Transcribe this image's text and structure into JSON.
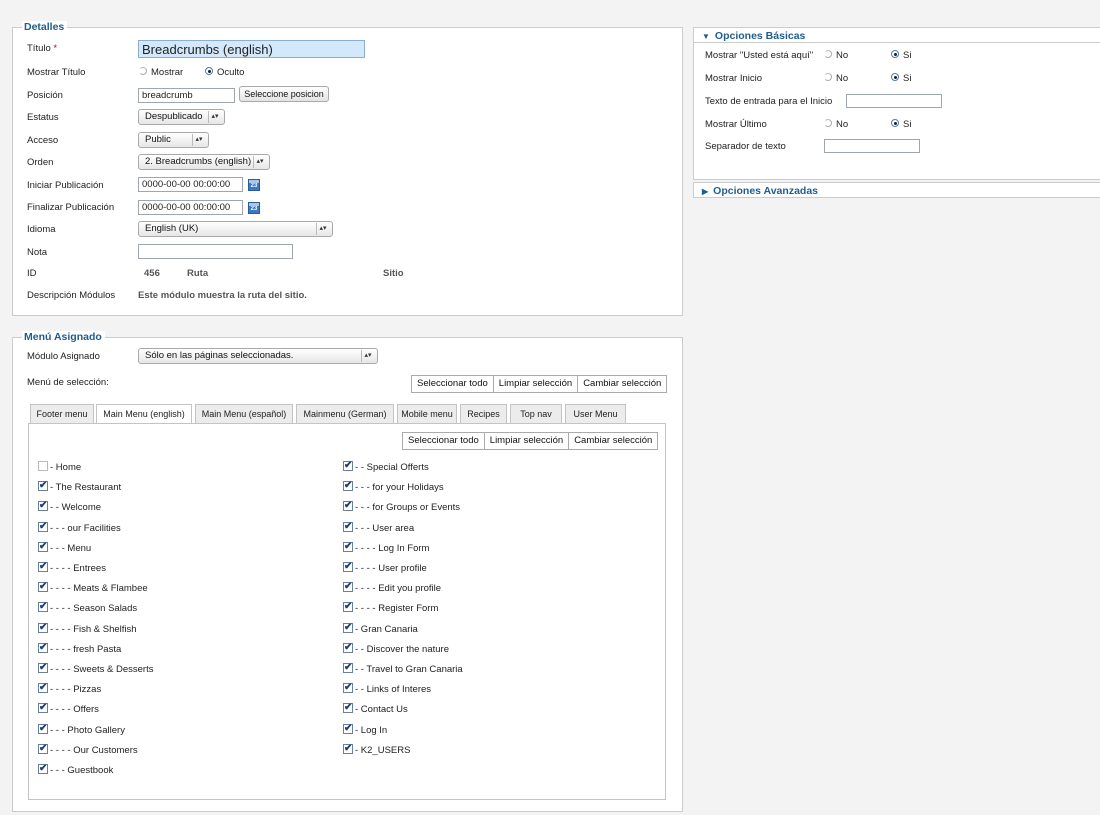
{
  "detalles": {
    "legend": "Detalles",
    "titulo_label": "Título",
    "required_mark": "*",
    "titulo_value": "Breadcrumbs (english)",
    "mostrar_titulo_label": "Mostrar Título",
    "mostrar_option": "Mostrar",
    "oculto_option": "Oculto",
    "posicion_label": "Posición",
    "posicion_value": "breadcrumb",
    "seleccione_posicion_btn": "Seleccione posicion",
    "estatus_label": "Estatus",
    "estatus_value": "Despublicado",
    "acceso_label": "Acceso",
    "acceso_value": "Public",
    "orden_label": "Orden",
    "orden_value": "2. Breadcrumbs (english)",
    "iniciar_label": "Iniciar Publicación",
    "iniciar_value": "0000-00-00 00:00:00",
    "finalizar_label": "Finalizar Publicación",
    "finalizar_value": "0000-00-00 00:00:00",
    "calendar_day": "23",
    "idioma_label": "Idioma",
    "idioma_value": "English (UK)",
    "nota_label": "Nota",
    "nota_value": "",
    "id_label": "ID",
    "id_value": "456",
    "ruta_label": "Ruta",
    "sitio_label": "Sitio",
    "descripcion_label": "Descripción Módulos",
    "descripcion_value": "Este módulo muestra la ruta del sitio."
  },
  "menu_asignado": {
    "legend": "Menú Asignado",
    "modulo_label": "Módulo Asignado",
    "modulo_value": "Sólo en las páginas seleccionadas.",
    "seleccion_label": "Menú de selección:",
    "seleccionar_todo": "Seleccionar todo",
    "limpiar_seleccion": "Limpiar selección",
    "cambiar_seleccion": "Cambiar selección",
    "tabs": [
      "Footer menu",
      "Main Menu (english)",
      "Main Menu (español)",
      "Mainmenu (German)",
      "Mobile menu",
      "Recipes",
      "Top nav",
      "User Menu"
    ],
    "active_tab": 1,
    "left_items": [
      {
        "label": "- Home",
        "checked": false
      },
      {
        "label": "- The Restaurant",
        "checked": true
      },
      {
        "label": "- - Welcome",
        "checked": true
      },
      {
        "label": "- - - our Facilities",
        "checked": true
      },
      {
        "label": "- - - Menu",
        "checked": true
      },
      {
        "label": "- - - - Entrees",
        "checked": true
      },
      {
        "label": "- - - - Meats & Flambee",
        "checked": true
      },
      {
        "label": "- - - - Season Salads",
        "checked": true
      },
      {
        "label": "- - - - Fish & Shelfish",
        "checked": true
      },
      {
        "label": "- - - - fresh Pasta",
        "checked": true
      },
      {
        "label": "- - - - Sweets & Desserts",
        "checked": true
      },
      {
        "label": "- - - - Pizzas",
        "checked": true
      },
      {
        "label": "- - - - Offers",
        "checked": true
      },
      {
        "label": "- - - Photo Gallery",
        "checked": true
      },
      {
        "label": "- - - - Our Customers",
        "checked": true
      },
      {
        "label": "- - - Guestbook",
        "checked": true
      }
    ],
    "right_items": [
      {
        "label": "- - Special Offerts",
        "checked": true
      },
      {
        "label": "- - - for your Holidays",
        "checked": true
      },
      {
        "label": "- - - for Groups or Events",
        "checked": true
      },
      {
        "label": "- - - User area",
        "checked": true
      },
      {
        "label": "- - - - Log In Form",
        "checked": true
      },
      {
        "label": "- - - - User profile",
        "checked": true
      },
      {
        "label": "- - - - Edit you profile",
        "checked": true
      },
      {
        "label": "- - - - Register Form",
        "checked": true
      },
      {
        "label": "- Gran Canaria",
        "checked": true
      },
      {
        "label": "- - Discover the nature",
        "checked": true
      },
      {
        "label": "- - Travel to Gran Canaria",
        "checked": true
      },
      {
        "label": "- - Links of Interes",
        "checked": true
      },
      {
        "label": "- Contact Us",
        "checked": true
      },
      {
        "label": "- Log In",
        "checked": true
      },
      {
        "label": "- K2_USERS",
        "checked": true
      }
    ]
  },
  "opciones_basicas": {
    "title": "Opciones Básicas",
    "usted_label": "Mostrar \"Usted está aquí\"",
    "inicio_label": "Mostrar Inicio",
    "texto_inicio_label": "Texto de entrada para el Inicio",
    "texto_inicio_value": "",
    "ultimo_label": "Mostrar Último",
    "separador_label": "Separador de texto",
    "separador_value": "",
    "no_option": "No",
    "si_option": "Si"
  },
  "opciones_avanzadas": {
    "title": "Opciones Avanzadas"
  }
}
